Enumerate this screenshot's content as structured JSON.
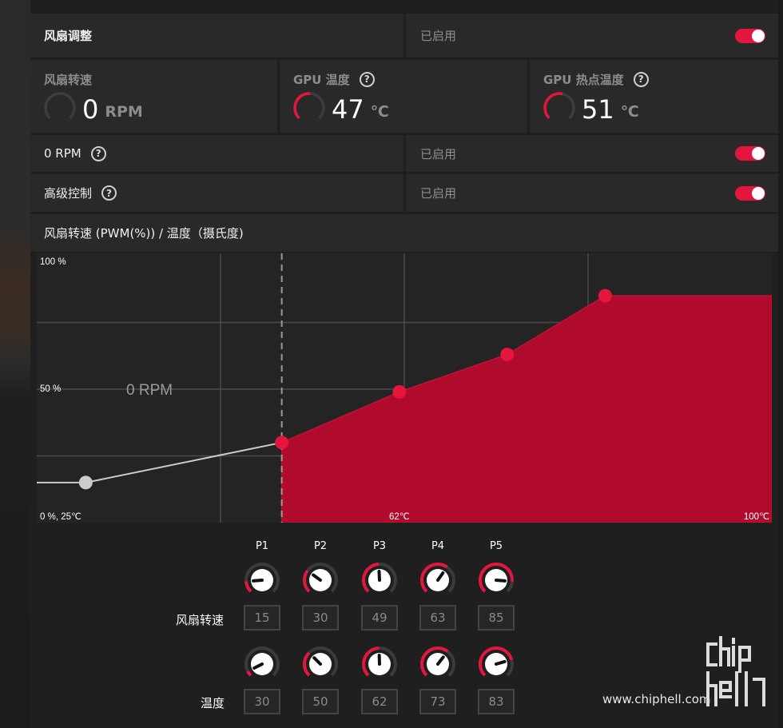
{
  "fan_tuning": {
    "label": "风扇调整",
    "state": "已启用",
    "enabled": true
  },
  "metrics": [
    {
      "title": "风扇转速",
      "value": "0",
      "unit": "RPM",
      "fraction": 0.0,
      "help": false
    },
    {
      "title": "GPU 温度",
      "value": "47",
      "unit": "℃",
      "fraction": 0.33,
      "help": true
    },
    {
      "title": "GPU 热点温度",
      "value": "51",
      "unit": "℃",
      "fraction": 0.36,
      "help": true
    }
  ],
  "zero_rpm": {
    "label": "0 RPM",
    "state": "已启用",
    "enabled": true
  },
  "advanced": {
    "label": "高级控制",
    "state": "已启用",
    "enabled": true
  },
  "chart_title": "风扇转速 (PWM(%)) / 温度（摄氏度)",
  "chart_data": {
    "type": "area",
    "ylabel_top": "100 %",
    "ylabel_mid": "50 %",
    "origin_label": "0 %, 25℃",
    "x_mid_label": "62℃",
    "x_max_label": "100℃",
    "zero_rpm_label": "0 RPM",
    "xlim": [
      25,
      100
    ],
    "ylim": [
      0,
      100
    ],
    "zero_rpm_temp": 50,
    "points": [
      {
        "name": "P1",
        "temp": 30,
        "speed": 15
      },
      {
        "name": "P2",
        "temp": 50,
        "speed": 30
      },
      {
        "name": "P3",
        "temp": 62,
        "speed": 49
      },
      {
        "name": "P4",
        "temp": 73,
        "speed": 63
      },
      {
        "name": "P5",
        "temp": 83,
        "speed": 85
      }
    ],
    "line_start": {
      "temp": 25,
      "speed": 15
    },
    "line_end": {
      "temp": 100,
      "speed": 85
    },
    "fill_color": "#b00a2c",
    "point_color": "#e4163d",
    "inactive_color": "#cccccc"
  },
  "controls": {
    "fan_speed_label": "风扇转速",
    "temperature_label": "温度",
    "points": [
      {
        "name": "P1",
        "speed": "15",
        "temp": "30"
      },
      {
        "name": "P2",
        "speed": "30",
        "temp": "50"
      },
      {
        "name": "P3",
        "speed": "49",
        "temp": "62"
      },
      {
        "name": "P4",
        "speed": "63",
        "temp": "73"
      },
      {
        "name": "P5",
        "speed": "85",
        "temp": "83"
      }
    ]
  },
  "watermark": {
    "text": "www.chiphell.com",
    "logo": "chip hell"
  },
  "colors": {
    "accent": "#e4163d",
    "panel": "#292929"
  }
}
